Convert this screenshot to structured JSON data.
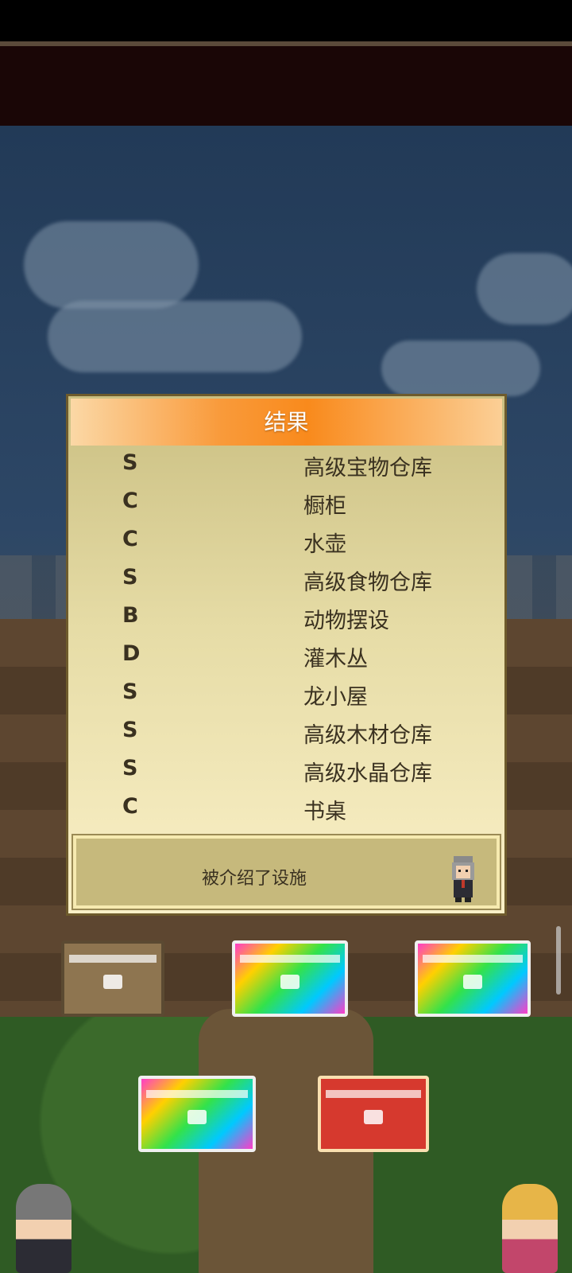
{
  "results_dialog": {
    "title": "结果",
    "rows": [
      {
        "grade": "S",
        "item": "高级宝物仓库"
      },
      {
        "grade": "C",
        "item": "橱柜"
      },
      {
        "grade": "C",
        "item": "水壶"
      },
      {
        "grade": "S",
        "item": "高级食物仓库"
      },
      {
        "grade": "B",
        "item": "动物摆设"
      },
      {
        "grade": "D",
        "item": "灌木丛"
      },
      {
        "grade": "S",
        "item": "龙小屋"
      },
      {
        "grade": "S",
        "item": "高级木材仓库"
      },
      {
        "grade": "S",
        "item": "高级水晶仓库"
      },
      {
        "grade": "C",
        "item": "书桌"
      }
    ],
    "message": "被介绍了设施"
  },
  "chests": [
    "wooden-chest",
    "rainbow-chest",
    "rainbow-chest",
    "rainbow-chest",
    "red-chest"
  ],
  "colors": {
    "header_orange": "#f98a1c",
    "panel_cream": "#faf0c7",
    "panel_tan": "#cabf82",
    "rainbow_chest": "#ff3cc8",
    "red_chest": "#d6392e"
  }
}
